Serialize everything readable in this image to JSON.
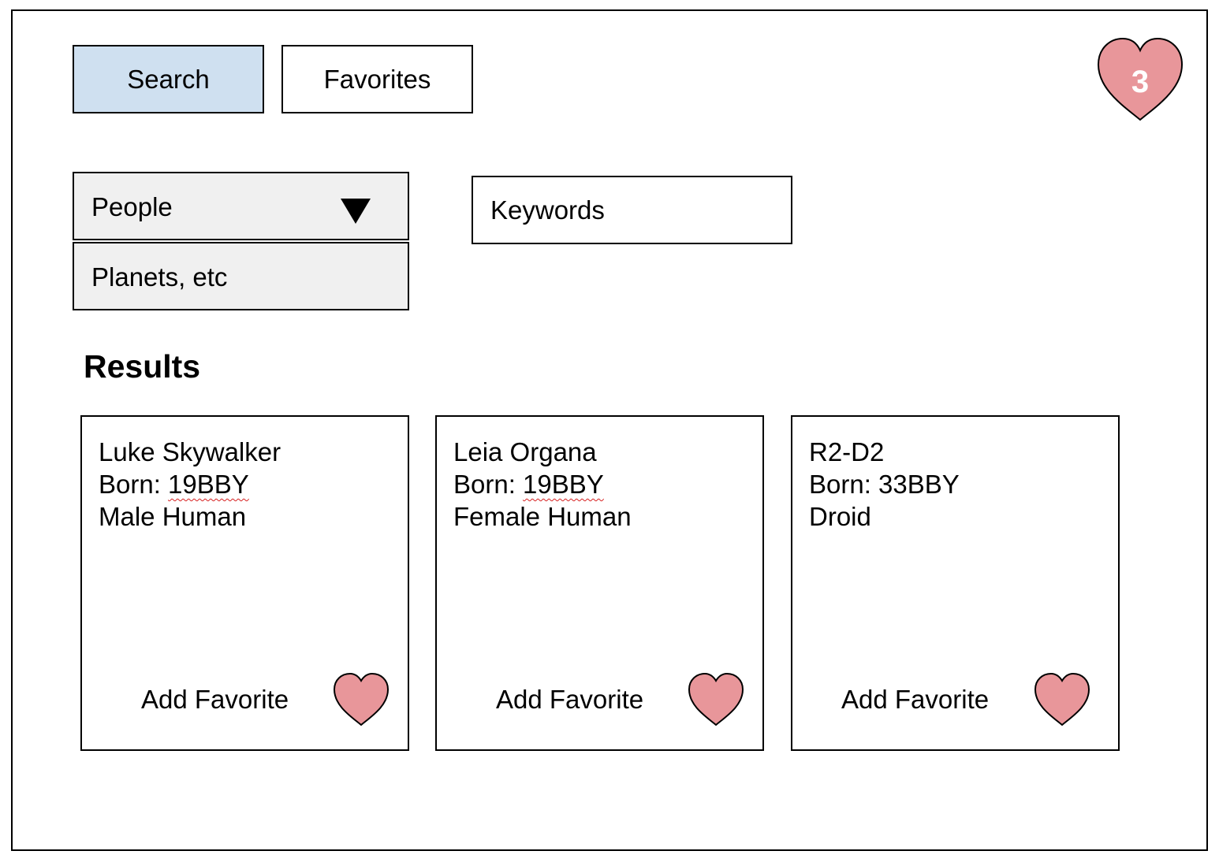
{
  "nav": {
    "search_label": "Search",
    "favorites_label": "Favorites"
  },
  "favorites_counter": {
    "count": "3",
    "icon": "heart-icon",
    "fill_color": "#e8969a"
  },
  "filter": {
    "selected": "People",
    "options": [
      "Planets, etc"
    ],
    "arrow_icon": "triangle-down-icon"
  },
  "keywords": {
    "placeholder": "Keywords",
    "value": ""
  },
  "results": {
    "heading": "Results",
    "cards": [
      {
        "name": "Luke Skywalker",
        "born_prefix": "Born: ",
        "born_value": "19BBY",
        "born_flagged": true,
        "description": "Male Human",
        "action_label": "Add Favorite"
      },
      {
        "name": "Leia Organa",
        "born_prefix": "Born: ",
        "born_value": "19BBY",
        "born_flagged": true,
        "description": "Female Human",
        "action_label": "Add Favorite"
      },
      {
        "name": "R2-D2",
        "born_prefix": "Born: ",
        "born_value": "33BBY",
        "born_flagged": false,
        "description": "Droid",
        "action_label": "Add Favorite"
      }
    ]
  },
  "colors": {
    "search_button_bg": "#cfe0f0",
    "select_bg": "#f0f0f0",
    "heart_fill": "#e8969a",
    "spellcheck": "#d62020"
  }
}
